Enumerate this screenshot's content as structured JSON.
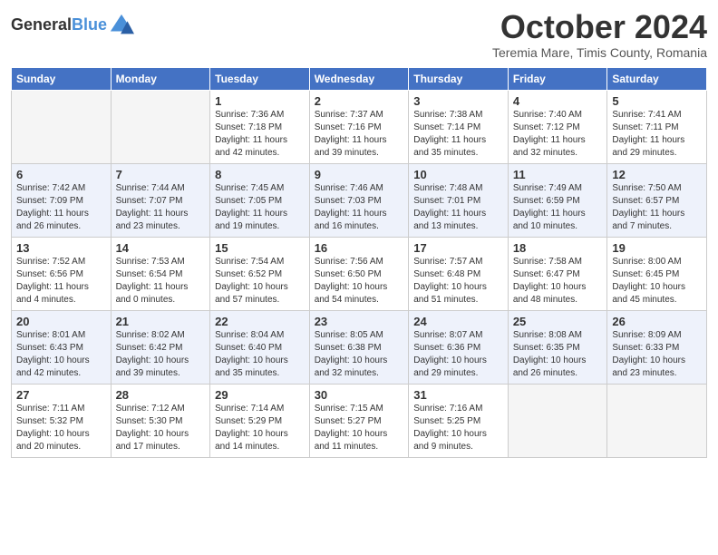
{
  "header": {
    "logo_line1": "General",
    "logo_line2": "Blue",
    "month_title": "October 2024",
    "subtitle": "Teremia Mare, Timis County, Romania"
  },
  "weekdays": [
    "Sunday",
    "Monday",
    "Tuesday",
    "Wednesday",
    "Thursday",
    "Friday",
    "Saturday"
  ],
  "weeks": [
    [
      {
        "day": "",
        "sunrise": "",
        "sunset": "",
        "daylight": "",
        "empty": true
      },
      {
        "day": "",
        "sunrise": "",
        "sunset": "",
        "daylight": "",
        "empty": true
      },
      {
        "day": "1",
        "sunrise": "Sunrise: 7:36 AM",
        "sunset": "Sunset: 7:18 PM",
        "daylight": "Daylight: 11 hours and 42 minutes.",
        "empty": false
      },
      {
        "day": "2",
        "sunrise": "Sunrise: 7:37 AM",
        "sunset": "Sunset: 7:16 PM",
        "daylight": "Daylight: 11 hours and 39 minutes.",
        "empty": false
      },
      {
        "day": "3",
        "sunrise": "Sunrise: 7:38 AM",
        "sunset": "Sunset: 7:14 PM",
        "daylight": "Daylight: 11 hours and 35 minutes.",
        "empty": false
      },
      {
        "day": "4",
        "sunrise": "Sunrise: 7:40 AM",
        "sunset": "Sunset: 7:12 PM",
        "daylight": "Daylight: 11 hours and 32 minutes.",
        "empty": false
      },
      {
        "day": "5",
        "sunrise": "Sunrise: 7:41 AM",
        "sunset": "Sunset: 7:11 PM",
        "daylight": "Daylight: 11 hours and 29 minutes.",
        "empty": false
      }
    ],
    [
      {
        "day": "6",
        "sunrise": "Sunrise: 7:42 AM",
        "sunset": "Sunset: 7:09 PM",
        "daylight": "Daylight: 11 hours and 26 minutes.",
        "empty": false
      },
      {
        "day": "7",
        "sunrise": "Sunrise: 7:44 AM",
        "sunset": "Sunset: 7:07 PM",
        "daylight": "Daylight: 11 hours and 23 minutes.",
        "empty": false
      },
      {
        "day": "8",
        "sunrise": "Sunrise: 7:45 AM",
        "sunset": "Sunset: 7:05 PM",
        "daylight": "Daylight: 11 hours and 19 minutes.",
        "empty": false
      },
      {
        "day": "9",
        "sunrise": "Sunrise: 7:46 AM",
        "sunset": "Sunset: 7:03 PM",
        "daylight": "Daylight: 11 hours and 16 minutes.",
        "empty": false
      },
      {
        "day": "10",
        "sunrise": "Sunrise: 7:48 AM",
        "sunset": "Sunset: 7:01 PM",
        "daylight": "Daylight: 11 hours and 13 minutes.",
        "empty": false
      },
      {
        "day": "11",
        "sunrise": "Sunrise: 7:49 AM",
        "sunset": "Sunset: 6:59 PM",
        "daylight": "Daylight: 11 hours and 10 minutes.",
        "empty": false
      },
      {
        "day": "12",
        "sunrise": "Sunrise: 7:50 AM",
        "sunset": "Sunset: 6:57 PM",
        "daylight": "Daylight: 11 hours and 7 minutes.",
        "empty": false
      }
    ],
    [
      {
        "day": "13",
        "sunrise": "Sunrise: 7:52 AM",
        "sunset": "Sunset: 6:56 PM",
        "daylight": "Daylight: 11 hours and 4 minutes.",
        "empty": false
      },
      {
        "day": "14",
        "sunrise": "Sunrise: 7:53 AM",
        "sunset": "Sunset: 6:54 PM",
        "daylight": "Daylight: 11 hours and 0 minutes.",
        "empty": false
      },
      {
        "day": "15",
        "sunrise": "Sunrise: 7:54 AM",
        "sunset": "Sunset: 6:52 PM",
        "daylight": "Daylight: 10 hours and 57 minutes.",
        "empty": false
      },
      {
        "day": "16",
        "sunrise": "Sunrise: 7:56 AM",
        "sunset": "Sunset: 6:50 PM",
        "daylight": "Daylight: 10 hours and 54 minutes.",
        "empty": false
      },
      {
        "day": "17",
        "sunrise": "Sunrise: 7:57 AM",
        "sunset": "Sunset: 6:48 PM",
        "daylight": "Daylight: 10 hours and 51 minutes.",
        "empty": false
      },
      {
        "day": "18",
        "sunrise": "Sunrise: 7:58 AM",
        "sunset": "Sunset: 6:47 PM",
        "daylight": "Daylight: 10 hours and 48 minutes.",
        "empty": false
      },
      {
        "day": "19",
        "sunrise": "Sunrise: 8:00 AM",
        "sunset": "Sunset: 6:45 PM",
        "daylight": "Daylight: 10 hours and 45 minutes.",
        "empty": false
      }
    ],
    [
      {
        "day": "20",
        "sunrise": "Sunrise: 8:01 AM",
        "sunset": "Sunset: 6:43 PM",
        "daylight": "Daylight: 10 hours and 42 minutes.",
        "empty": false
      },
      {
        "day": "21",
        "sunrise": "Sunrise: 8:02 AM",
        "sunset": "Sunset: 6:42 PM",
        "daylight": "Daylight: 10 hours and 39 minutes.",
        "empty": false
      },
      {
        "day": "22",
        "sunrise": "Sunrise: 8:04 AM",
        "sunset": "Sunset: 6:40 PM",
        "daylight": "Daylight: 10 hours and 35 minutes.",
        "empty": false
      },
      {
        "day": "23",
        "sunrise": "Sunrise: 8:05 AM",
        "sunset": "Sunset: 6:38 PM",
        "daylight": "Daylight: 10 hours and 32 minutes.",
        "empty": false
      },
      {
        "day": "24",
        "sunrise": "Sunrise: 8:07 AM",
        "sunset": "Sunset: 6:36 PM",
        "daylight": "Daylight: 10 hours and 29 minutes.",
        "empty": false
      },
      {
        "day": "25",
        "sunrise": "Sunrise: 8:08 AM",
        "sunset": "Sunset: 6:35 PM",
        "daylight": "Daylight: 10 hours and 26 minutes.",
        "empty": false
      },
      {
        "day": "26",
        "sunrise": "Sunrise: 8:09 AM",
        "sunset": "Sunset: 6:33 PM",
        "daylight": "Daylight: 10 hours and 23 minutes.",
        "empty": false
      }
    ],
    [
      {
        "day": "27",
        "sunrise": "Sunrise: 7:11 AM",
        "sunset": "Sunset: 5:32 PM",
        "daylight": "Daylight: 10 hours and 20 minutes.",
        "empty": false
      },
      {
        "day": "28",
        "sunrise": "Sunrise: 7:12 AM",
        "sunset": "Sunset: 5:30 PM",
        "daylight": "Daylight: 10 hours and 17 minutes.",
        "empty": false
      },
      {
        "day": "29",
        "sunrise": "Sunrise: 7:14 AM",
        "sunset": "Sunset: 5:29 PM",
        "daylight": "Daylight: 10 hours and 14 minutes.",
        "empty": false
      },
      {
        "day": "30",
        "sunrise": "Sunrise: 7:15 AM",
        "sunset": "Sunset: 5:27 PM",
        "daylight": "Daylight: 10 hours and 11 minutes.",
        "empty": false
      },
      {
        "day": "31",
        "sunrise": "Sunrise: 7:16 AM",
        "sunset": "Sunset: 5:25 PM",
        "daylight": "Daylight: 10 hours and 9 minutes.",
        "empty": false
      },
      {
        "day": "",
        "sunrise": "",
        "sunset": "",
        "daylight": "",
        "empty": true
      },
      {
        "day": "",
        "sunrise": "",
        "sunset": "",
        "daylight": "",
        "empty": true
      }
    ]
  ]
}
